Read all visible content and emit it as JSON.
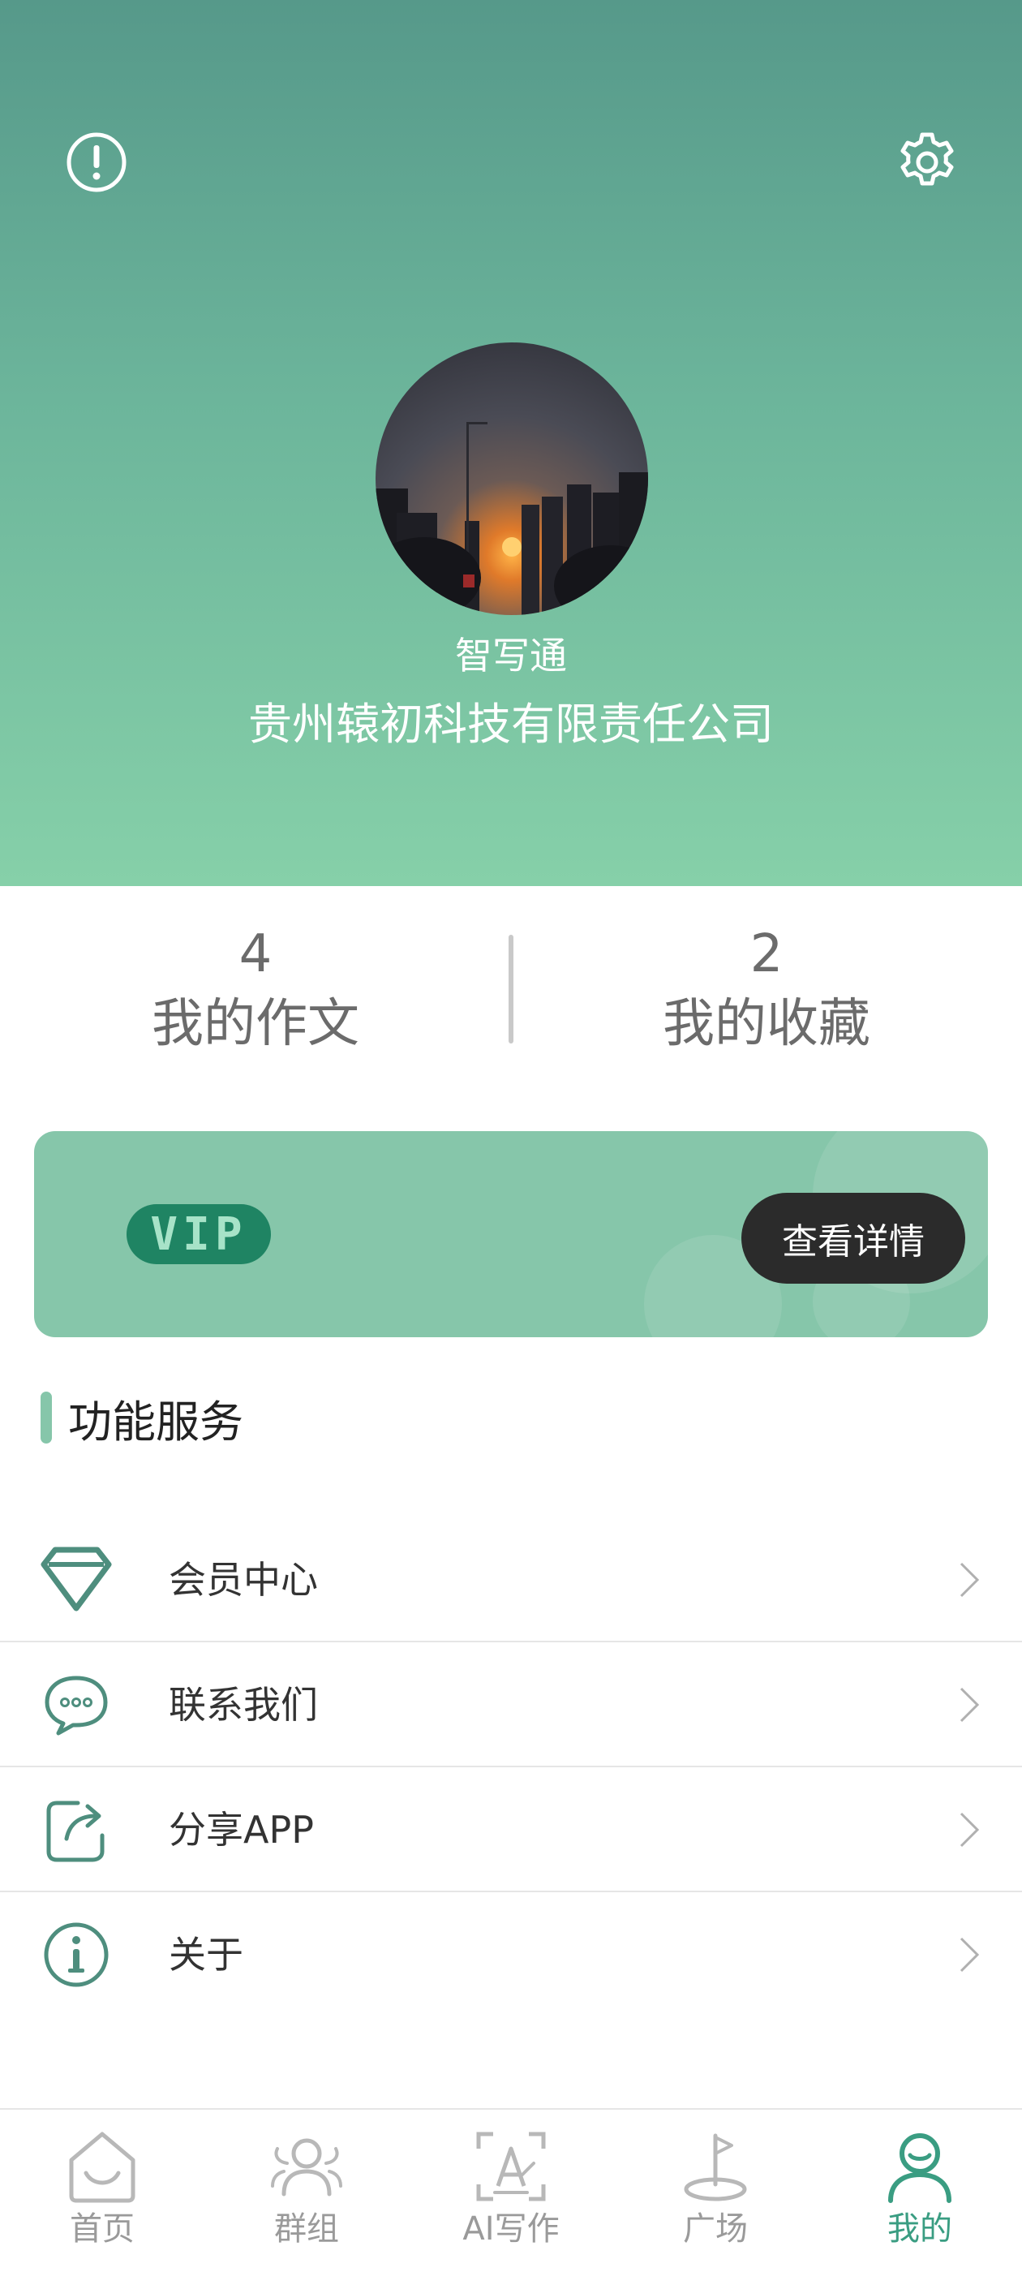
{
  "header": {
    "app_name": "智写通",
    "company_name": "贵州辕初科技有限责任公司",
    "avatar_alt": "sunset-city-avatar"
  },
  "stats": {
    "essays_count": "4",
    "essays_label": "我的作文",
    "favorites_count": "2",
    "favorites_label": "我的收藏"
  },
  "vip": {
    "badge": "VIP",
    "details_button": "查看详情"
  },
  "services": {
    "title": "功能服务",
    "items": [
      {
        "label": "会员中心",
        "icon": "diamond-icon"
      },
      {
        "label": "联系我们",
        "icon": "chat-bubble-icon"
      },
      {
        "label": "分享APP",
        "icon": "share-icon"
      },
      {
        "label": "关于",
        "icon": "info-icon"
      }
    ]
  },
  "tabbar": {
    "tabs": [
      {
        "label": "首页",
        "icon": "home-icon"
      },
      {
        "label": "群组",
        "icon": "group-icon"
      },
      {
        "label": "AI写作",
        "icon": "ai-writing-icon"
      },
      {
        "label": "广场",
        "icon": "plaza-icon"
      },
      {
        "label": "我的",
        "icon": "profile-icon",
        "active": true
      }
    ]
  },
  "colors": {
    "accent": "#3a9d82",
    "header_top": "#56998a",
    "header_bottom": "#86d0a9",
    "vip_card": "#86c6aa",
    "inactive_tab": "#9a9a9a"
  }
}
